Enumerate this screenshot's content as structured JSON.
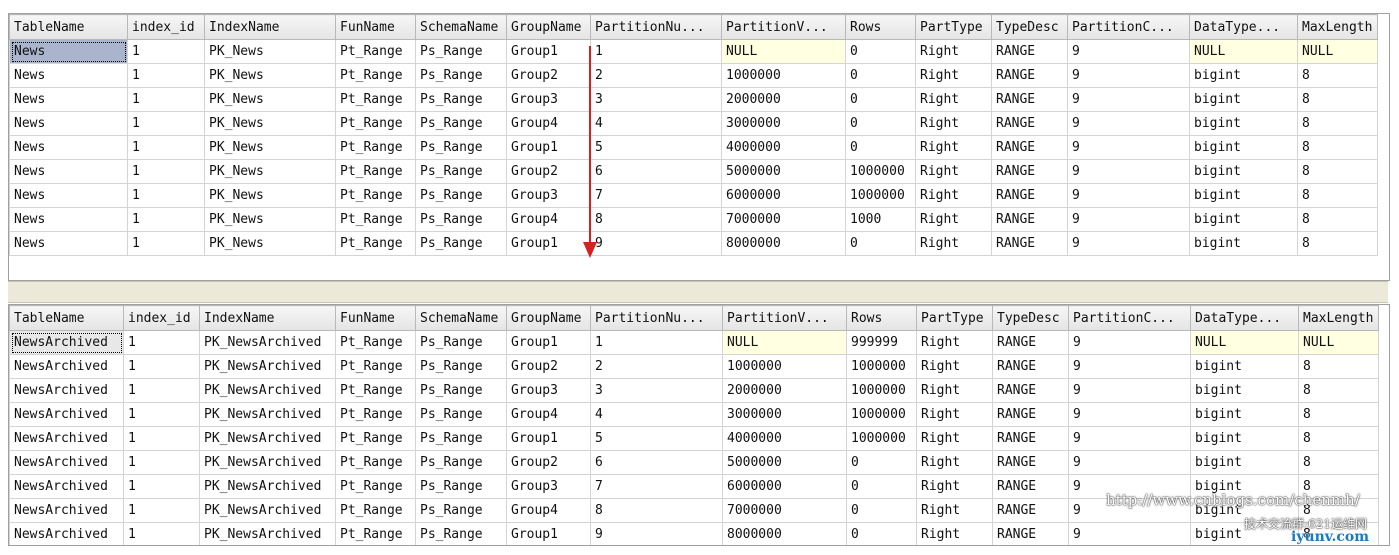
{
  "grid_top": {
    "columns": [
      "TableName",
      "index_id",
      "IndexName",
      "FunName",
      "SchemaName",
      "GroupName",
      "PartitionNu...",
      "PartitionV...",
      "Rows",
      "PartType",
      "TypeDesc",
      "PartitionC...",
      "DataType...",
      "MaxLength"
    ],
    "rows": [
      [
        "News",
        "1",
        "PK_News",
        "Pt_Range",
        "Ps_Range",
        "Group1",
        "1",
        "NULL",
        "0",
        "Right",
        "RANGE",
        "9",
        "NULL",
        "NULL"
      ],
      [
        "News",
        "1",
        "PK_News",
        "Pt_Range",
        "Ps_Range",
        "Group2",
        "2",
        "1000000",
        "0",
        "Right",
        "RANGE",
        "9",
        "bigint",
        "8"
      ],
      [
        "News",
        "1",
        "PK_News",
        "Pt_Range",
        "Ps_Range",
        "Group3",
        "3",
        "2000000",
        "0",
        "Right",
        "RANGE",
        "9",
        "bigint",
        "8"
      ],
      [
        "News",
        "1",
        "PK_News",
        "Pt_Range",
        "Ps_Range",
        "Group4",
        "4",
        "3000000",
        "0",
        "Right",
        "RANGE",
        "9",
        "bigint",
        "8"
      ],
      [
        "News",
        "1",
        "PK_News",
        "Pt_Range",
        "Ps_Range",
        "Group1",
        "5",
        "4000000",
        "0",
        "Right",
        "RANGE",
        "9",
        "bigint",
        "8"
      ],
      [
        "News",
        "1",
        "PK_News",
        "Pt_Range",
        "Ps_Range",
        "Group2",
        "6",
        "5000000",
        "1000000",
        "Right",
        "RANGE",
        "9",
        "bigint",
        "8"
      ],
      [
        "News",
        "1",
        "PK_News",
        "Pt_Range",
        "Ps_Range",
        "Group3",
        "7",
        "6000000",
        "1000000",
        "Right",
        "RANGE",
        "9",
        "bigint",
        "8"
      ],
      [
        "News",
        "1",
        "PK_News",
        "Pt_Range",
        "Ps_Range",
        "Group4",
        "8",
        "7000000",
        "1000",
        "Right",
        "RANGE",
        "9",
        "bigint",
        "8"
      ],
      [
        "News",
        "1",
        "PK_News",
        "Pt_Range",
        "Ps_Range",
        "Group1",
        "9",
        "8000000",
        "0",
        "Right",
        "RANGE",
        "9",
        "bigint",
        "8"
      ]
    ]
  },
  "grid_bottom": {
    "columns": [
      "TableName",
      "index_id",
      "IndexName",
      "FunName",
      "SchemaName",
      "GroupName",
      "PartitionNu...",
      "PartitionV...",
      "Rows",
      "PartType",
      "TypeDesc",
      "PartitionC...",
      "DataType...",
      "MaxLength"
    ],
    "rows": [
      [
        "NewsArchived",
        "1",
        "PK_NewsArchived",
        "Pt_Range",
        "Ps_Range",
        "Group1",
        "1",
        "NULL",
        "999999",
        "Right",
        "RANGE",
        "9",
        "NULL",
        "NULL"
      ],
      [
        "NewsArchived",
        "1",
        "PK_NewsArchived",
        "Pt_Range",
        "Ps_Range",
        "Group2",
        "2",
        "1000000",
        "1000000",
        "Right",
        "RANGE",
        "9",
        "bigint",
        "8"
      ],
      [
        "NewsArchived",
        "1",
        "PK_NewsArchived",
        "Pt_Range",
        "Ps_Range",
        "Group3",
        "3",
        "2000000",
        "1000000",
        "Right",
        "RANGE",
        "9",
        "bigint",
        "8"
      ],
      [
        "NewsArchived",
        "1",
        "PK_NewsArchived",
        "Pt_Range",
        "Ps_Range",
        "Group4",
        "4",
        "3000000",
        "1000000",
        "Right",
        "RANGE",
        "9",
        "bigint",
        "8"
      ],
      [
        "NewsArchived",
        "1",
        "PK_NewsArchived",
        "Pt_Range",
        "Ps_Range",
        "Group1",
        "5",
        "4000000",
        "1000000",
        "Right",
        "RANGE",
        "9",
        "bigint",
        "8"
      ],
      [
        "NewsArchived",
        "1",
        "PK_NewsArchived",
        "Pt_Range",
        "Ps_Range",
        "Group2",
        "6",
        "5000000",
        "0",
        "Right",
        "RANGE",
        "9",
        "bigint",
        "8"
      ],
      [
        "NewsArchived",
        "1",
        "PK_NewsArchived",
        "Pt_Range",
        "Ps_Range",
        "Group3",
        "7",
        "6000000",
        "0",
        "Right",
        "RANGE",
        "9",
        "bigint",
        "8"
      ],
      [
        "NewsArchived",
        "1",
        "PK_NewsArchived",
        "Pt_Range",
        "Ps_Range",
        "Group4",
        "8",
        "7000000",
        "0",
        "Right",
        "RANGE",
        "9",
        "bigint",
        "8"
      ],
      [
        "NewsArchived",
        "1",
        "PK_NewsArchived",
        "Pt_Range",
        "Ps_Range",
        "Group1",
        "9",
        "8000000",
        "0",
        "Right",
        "RANGE",
        "9",
        "bigint",
        "8"
      ]
    ]
  },
  "watermark": {
    "url": "http://www.cnblogs.com/chenmh/",
    "line2": "技术交流群:621运维网",
    "site": "iyunv.com"
  },
  "colors": {
    "null_cell": "#ffffe1",
    "selected_cell": "#aab4cc",
    "arrow": "#d82020"
  }
}
